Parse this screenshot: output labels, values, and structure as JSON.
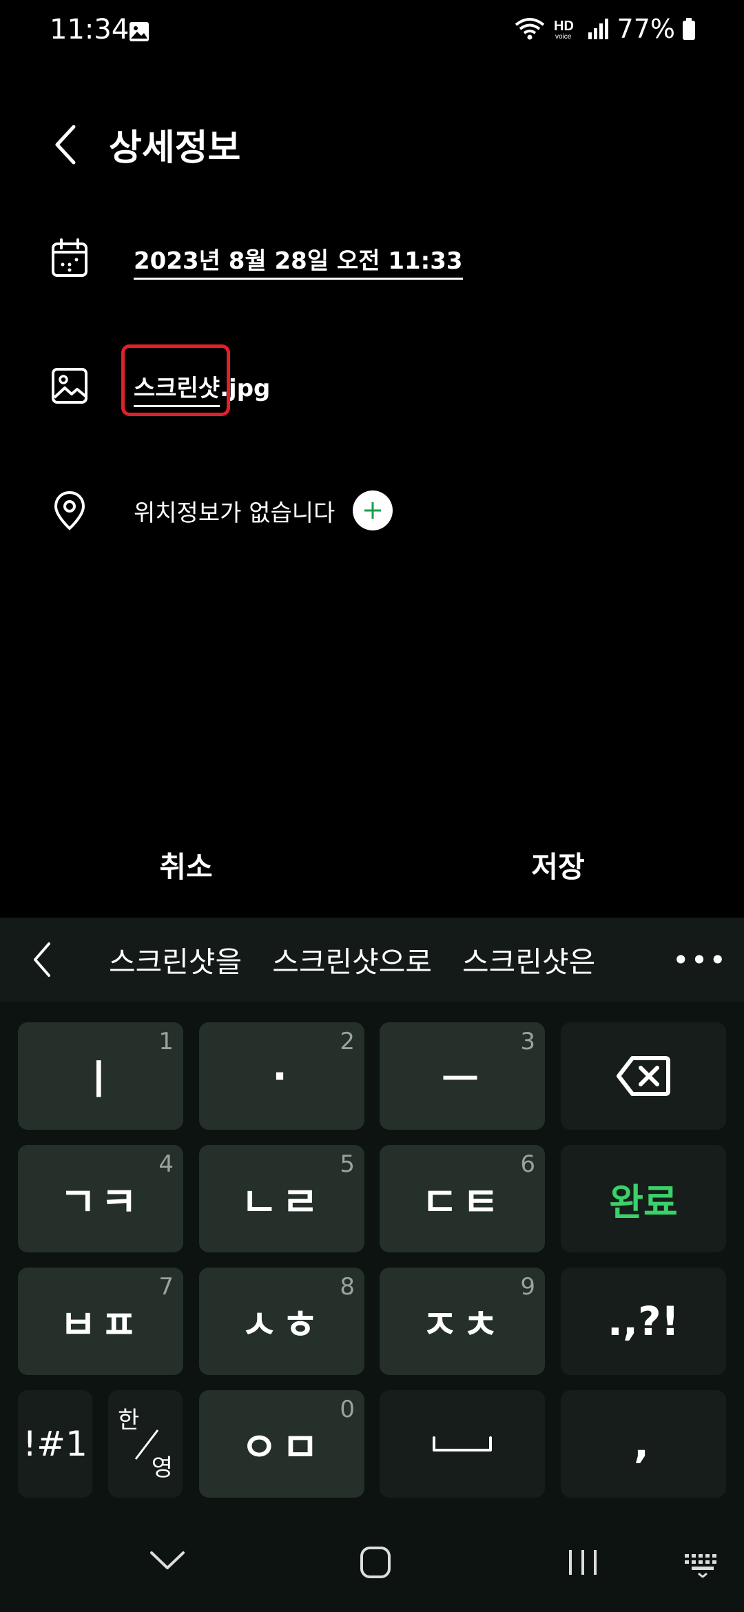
{
  "status_bar": {
    "time": "11:34",
    "battery": "77%"
  },
  "header": {
    "title": "상세정보"
  },
  "details": {
    "date": "2023년 8월 28일 오전 11:33",
    "file_name_editable": "스크린샷",
    "file_name_rest": ".jpg",
    "location_text": "위치정보가 없습니다"
  },
  "actions": {
    "cancel": "취소",
    "save": "저장"
  },
  "keyboard": {
    "suggestions": [
      "스크린샷을",
      "스크린샷으로",
      "스크린샷은"
    ],
    "more": "•••",
    "keys": {
      "k1": {
        "label": "ㅣ",
        "num": "1"
      },
      "k2": {
        "label": "·",
        "num": "2"
      },
      "k3": {
        "label": "ㅡ",
        "num": "3"
      },
      "k4": {
        "label": "ㄱㅋ",
        "num": "4"
      },
      "k5": {
        "label": "ㄴㄹ",
        "num": "5"
      },
      "k6": {
        "label": "ㄷㅌ",
        "num": "6"
      },
      "done": "완료",
      "k7": {
        "label": "ㅂㅍ",
        "num": "7"
      },
      "k8": {
        "label": "ㅅㅎ",
        "num": "8"
      },
      "k9": {
        "label": "ㅈㅊ",
        "num": "9"
      },
      "punct": ".,?!",
      "symbols": "!#1",
      "lang_top": "한",
      "lang_bottom": "영",
      "k0": {
        "label": "ㅇㅁ",
        "num": "0"
      },
      "comma": ","
    }
  },
  "colors": {
    "accent_green": "#3bd16b",
    "highlight_red": "#e0202a",
    "key_bg": "#243029"
  }
}
